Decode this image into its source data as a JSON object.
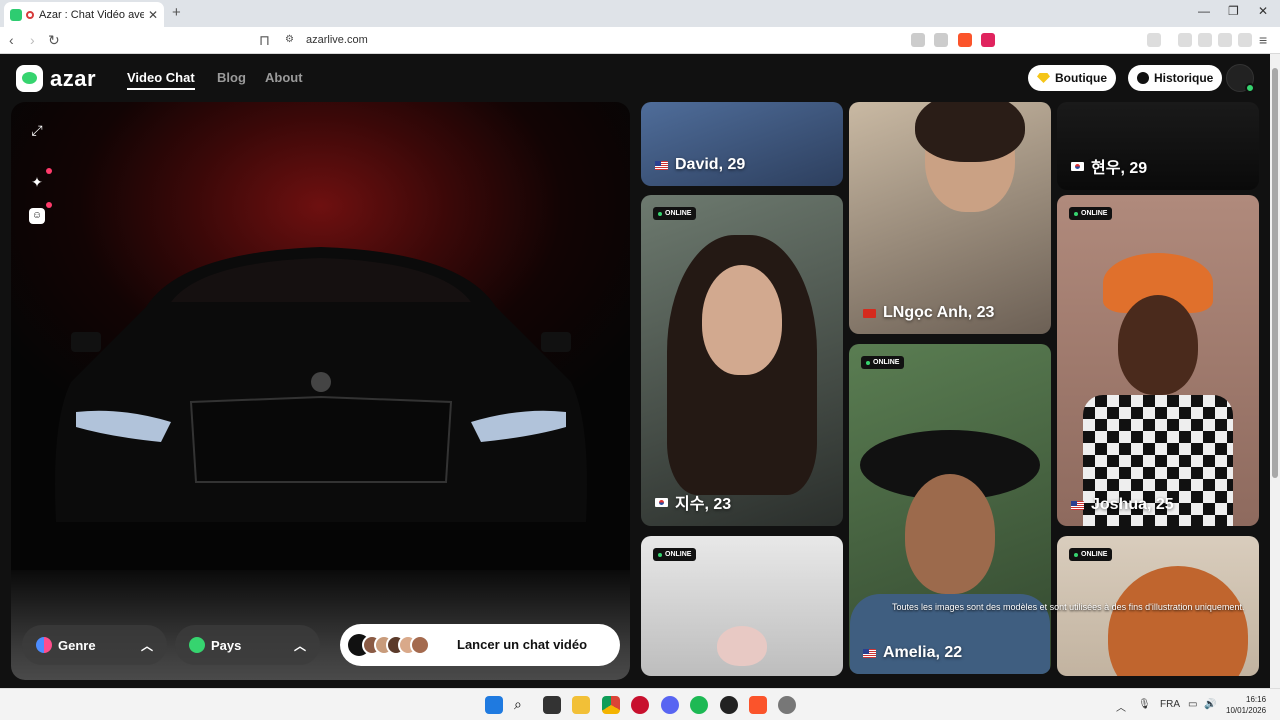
{
  "browser": {
    "tab_title": "Azar : Chat Vidéo avec de no",
    "new_tab": "+",
    "url": "azarlive.com"
  },
  "header": {
    "logo_text": "azar",
    "nav": [
      {
        "label": "Video Chat",
        "active": true
      },
      {
        "label": "Blog",
        "active": false
      },
      {
        "label": "About",
        "active": false
      }
    ],
    "boutique_label": "Boutique",
    "historique_label": "Historique"
  },
  "controls": {
    "genre_label": "Genre",
    "pays_label": "Pays",
    "launch_label": "Lancer un chat vidéo"
  },
  "profiles": [
    {
      "name": "David, 29",
      "flag": "us",
      "online": false
    },
    {
      "name": "LNgọc Anh, 23",
      "flag": "vn",
      "online": false
    },
    {
      "name": "현우, 29",
      "flag": "kr",
      "online": false
    },
    {
      "name": "지수, 23",
      "flag": "kr",
      "online": true
    },
    {
      "name": "Joshua, 25",
      "flag": "us",
      "online": true
    },
    {
      "name": "Amelia, 22",
      "flag": "us",
      "online": true
    },
    {
      "name": "",
      "flag": "",
      "online": true
    },
    {
      "name": "",
      "flag": "",
      "online": true
    }
  ],
  "online_label": "ONLINE",
  "disclaimer": "Toutes les images sont des modèles et sont utilisées à des fins d'illustration uniquement.",
  "taskbar": {
    "lang": "FRA",
    "time": "16:16",
    "date": "10/01/2026"
  },
  "colors": {
    "accent_green": "#36d46f",
    "badge_red": "#ff3b6b",
    "site_bg": "#111111"
  }
}
